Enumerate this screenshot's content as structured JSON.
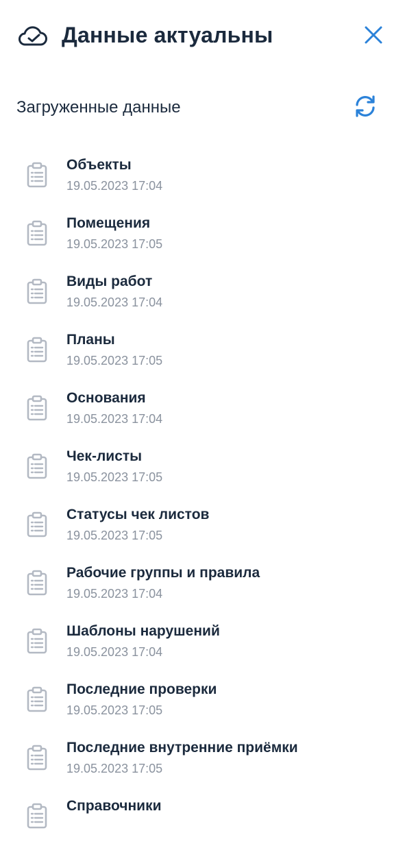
{
  "header": {
    "title": "Данные актуальны",
    "icon": "cloud-check-icon",
    "close_icon": "close-icon",
    "accent_color": "#2b82d9"
  },
  "section": {
    "title": "Загруженные данные",
    "refresh_icon": "refresh-icon"
  },
  "items": [
    {
      "name": "Объекты",
      "date": "19.05.2023 17:04"
    },
    {
      "name": "Помещения",
      "date": "19.05.2023 17:05"
    },
    {
      "name": "Виды работ",
      "date": "19.05.2023 17:04"
    },
    {
      "name": "Планы",
      "date": "19.05.2023 17:05"
    },
    {
      "name": "Основания",
      "date": "19.05.2023 17:04"
    },
    {
      "name": "Чек-листы",
      "date": "19.05.2023 17:05"
    },
    {
      "name": "Статусы чек листов",
      "date": "19.05.2023 17:05"
    },
    {
      "name": "Рабочие группы и правила",
      "date": "19.05.2023 17:04"
    },
    {
      "name": "Шаблоны нарушений",
      "date": "19.05.2023 17:04"
    },
    {
      "name": "Последние проверки",
      "date": "19.05.2023 17:05"
    },
    {
      "name": "Последние внутренние приёмки",
      "date": "19.05.2023 17:05"
    },
    {
      "name": "Справочники",
      "date": ""
    }
  ],
  "item_icon": "clipboard-icon"
}
